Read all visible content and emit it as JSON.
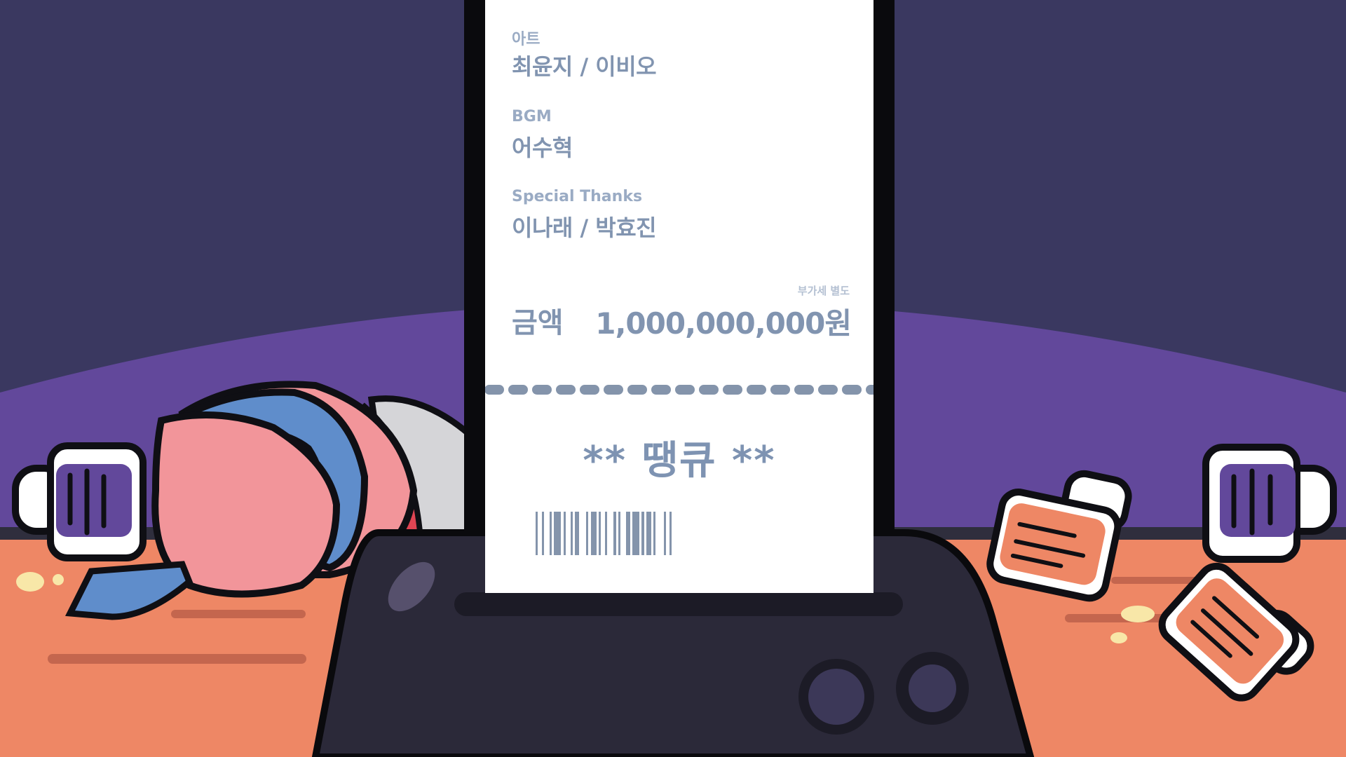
{
  "credits": [
    {
      "role": "아트",
      "names": "최윤지 / 이비오"
    },
    {
      "role": "BGM",
      "names": "어수혁"
    },
    {
      "role": "Special Thanks",
      "names": "이나래 / 박효진"
    }
  ],
  "amount": {
    "label": "금액",
    "value": "1,000,000,000원",
    "vat_note": "부가세 별도"
  },
  "thanks": "** 땡큐 **",
  "colors": {
    "background": "#3a3860",
    "stage": "#62489b",
    "table": "#ee8765",
    "printer": "#2b2939",
    "receipt_text": "#8194b0"
  }
}
